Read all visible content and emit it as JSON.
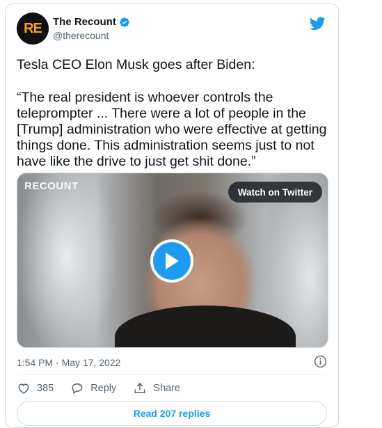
{
  "author": {
    "avatar_text": "RE",
    "display_name": "The Recount",
    "handle": "@therecount",
    "verified": true
  },
  "tweet": {
    "paragraphs": [
      "Tesla CEO Elon Musk goes after Biden:",
      "“The real president is whoever controls the teleprompter ... There were a lot of people in the [Trump] administration who were effective at getting things done. This administration seems just to not have like the drive to just get shit done.”"
    ]
  },
  "media": {
    "watermark": "RECOUNT",
    "watch_label": "Watch on Twitter"
  },
  "timestamp": "1:54 PM · May 17, 2022",
  "actions": {
    "like_count": "385",
    "reply_label": "Reply",
    "share_label": "Share"
  },
  "read_replies_label": "Read 207 replies",
  "colors": {
    "accent": "#1d9bf0",
    "text": "#0f1419",
    "muted": "#536471",
    "border": "#cfd9de"
  }
}
